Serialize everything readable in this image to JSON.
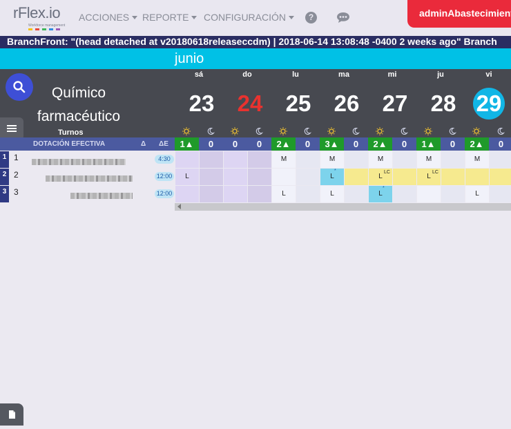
{
  "app": {
    "logo": "rFlex.io",
    "logo_tagline": "Workforce management"
  },
  "nav": {
    "acciones": "ACCIONES",
    "reporte": "REPORTE",
    "configuracion": "CONFIGURACIÓN",
    "user": "adminAbastecimiento"
  },
  "branch": "BranchFront: \"(head detached at v20180618releaseccdm) | 2018-06-14 13:08:48 -0400 2 weeks ago\" Branch",
  "calendar": {
    "month": "junio",
    "specialty": "Químico farmacéutico",
    "turnos": "Turnos",
    "dotacion": "DOTACIÓN EFECTIVA",
    "delta": "Δ",
    "delta_e": "ΔE",
    "days": [
      {
        "dow": "sá",
        "num": "23",
        "day_count": "1▲",
        "night_count": "0"
      },
      {
        "dow": "do",
        "num": "24",
        "day_count": "0",
        "night_count": "0"
      },
      {
        "dow": "lu",
        "num": "25",
        "day_count": "2▲",
        "night_count": "0"
      },
      {
        "dow": "ma",
        "num": "26",
        "day_count": "3▲",
        "night_count": "0"
      },
      {
        "dow": "mi",
        "num": "27",
        "day_count": "2▲",
        "night_count": "0"
      },
      {
        "dow": "ju",
        "num": "28",
        "day_count": "1▲",
        "night_count": "0"
      },
      {
        "dow": "vi",
        "num": "29",
        "day_count": "2▲",
        "night_count": "0"
      }
    ],
    "rows": [
      {
        "idx": "1",
        "num": "1",
        "hours": "4:30"
      },
      {
        "idx": "2",
        "num": "2",
        "hours": "12:00"
      },
      {
        "idx": "3",
        "num": "3",
        "hours": "12:00"
      }
    ],
    "shift_codes": {
      "r1": [
        "",
        "",
        "",
        "",
        "M",
        "",
        "M",
        "",
        "M",
        "",
        "M",
        "",
        "M",
        ""
      ],
      "r2": [
        "L",
        "",
        "",
        "",
        "",
        "",
        "L",
        "",
        "L",
        "",
        "L",
        "",
        "",
        ""
      ],
      "r3": [
        "",
        "",
        "",
        "",
        "L",
        "",
        "L",
        "",
        "L",
        "",
        "",
        "",
        "L",
        ""
      ]
    },
    "superscripts": {
      "lc": "LC",
      "star": "*"
    }
  },
  "colors": {
    "accent_red": "#ea2a3b",
    "brand_navy": "#2a2d62",
    "month_cyan": "#00c1e6",
    "today_circle": "#11b6e6",
    "count_green": "#1f9a2a"
  }
}
